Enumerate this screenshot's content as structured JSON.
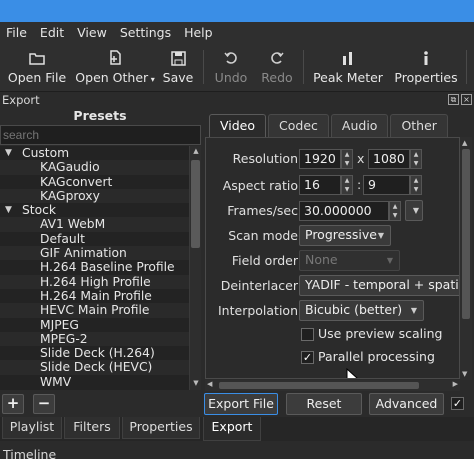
{
  "menu": [
    "File",
    "Edit",
    "View",
    "Settings",
    "Help"
  ],
  "toolbar": {
    "open_file": "Open File",
    "open_other": "Open Other",
    "save": "Save",
    "undo": "Undo",
    "redo": "Redo",
    "peak_meter": "Peak Meter",
    "properties": "Properties",
    "icons": [
      "open-folder-icon",
      "open-other-icon",
      "save-disk-icon",
      "undo-icon",
      "redo-icon",
      "peak-meter-icon",
      "info-icon"
    ]
  },
  "dock": {
    "title": "Export"
  },
  "presets": {
    "title": "Presets",
    "search_placeholder": "search",
    "tree": [
      {
        "label": "Custom",
        "type": "group",
        "expanded": true
      },
      {
        "label": "KAGaudio",
        "type": "leaf"
      },
      {
        "label": "KAGconvert",
        "type": "leaf"
      },
      {
        "label": "KAGproxy",
        "type": "leaf"
      },
      {
        "label": "Stock",
        "type": "group",
        "expanded": true
      },
      {
        "label": "AV1 WebM",
        "type": "leaf"
      },
      {
        "label": "Default",
        "type": "leaf"
      },
      {
        "label": "GIF Animation",
        "type": "leaf"
      },
      {
        "label": "H.264 Baseline Profile",
        "type": "leaf"
      },
      {
        "label": "H.264 High Profile",
        "type": "leaf"
      },
      {
        "label": "H.264 Main Profile",
        "type": "leaf"
      },
      {
        "label": "HEVC Main Profile",
        "type": "leaf"
      },
      {
        "label": "MJPEG",
        "type": "leaf"
      },
      {
        "label": "MPEG-2",
        "type": "leaf"
      },
      {
        "label": "Slide Deck (H.264)",
        "type": "leaf"
      },
      {
        "label": "Slide Deck (HEVC)",
        "type": "leaf"
      },
      {
        "label": "WMV",
        "type": "leaf"
      }
    ]
  },
  "tabs": [
    "Video",
    "Codec",
    "Audio",
    "Other"
  ],
  "video": {
    "resolution_label": "Resolution",
    "width": "1920",
    "height": "1080",
    "x_sep": "x",
    "aspect_label": "Aspect ratio",
    "aspect_num": "16",
    "aspect_den": "9",
    "colon_sep": ":",
    "fps_label": "Frames/sec",
    "fps": "30.000000",
    "scan_label": "Scan mode",
    "scan_value": "Progressive",
    "field_label": "Field order",
    "field_value": "None",
    "deint_label": "Deinterlacer",
    "deint_value": "YADIF - temporal + spatial",
    "interp_label": "Interpolation",
    "interp_value": "Bicubic (better)",
    "preview_scaling_label": "Use preview scaling",
    "preview_scaling_checked": false,
    "parallel_label": "Parallel processing",
    "parallel_checked": true
  },
  "buttons": {
    "add": "+",
    "remove": "−",
    "export_file": "Export File",
    "reset": "Reset",
    "advanced": "Advanced"
  },
  "bottom_tabs": [
    "Playlist",
    "Filters",
    "Properties",
    "Export"
  ],
  "timeline_label": "Timeline",
  "colors": {
    "titlebar": "#3a8ee6",
    "background": "#2b2b2b",
    "focus": "#3a8ee6"
  }
}
